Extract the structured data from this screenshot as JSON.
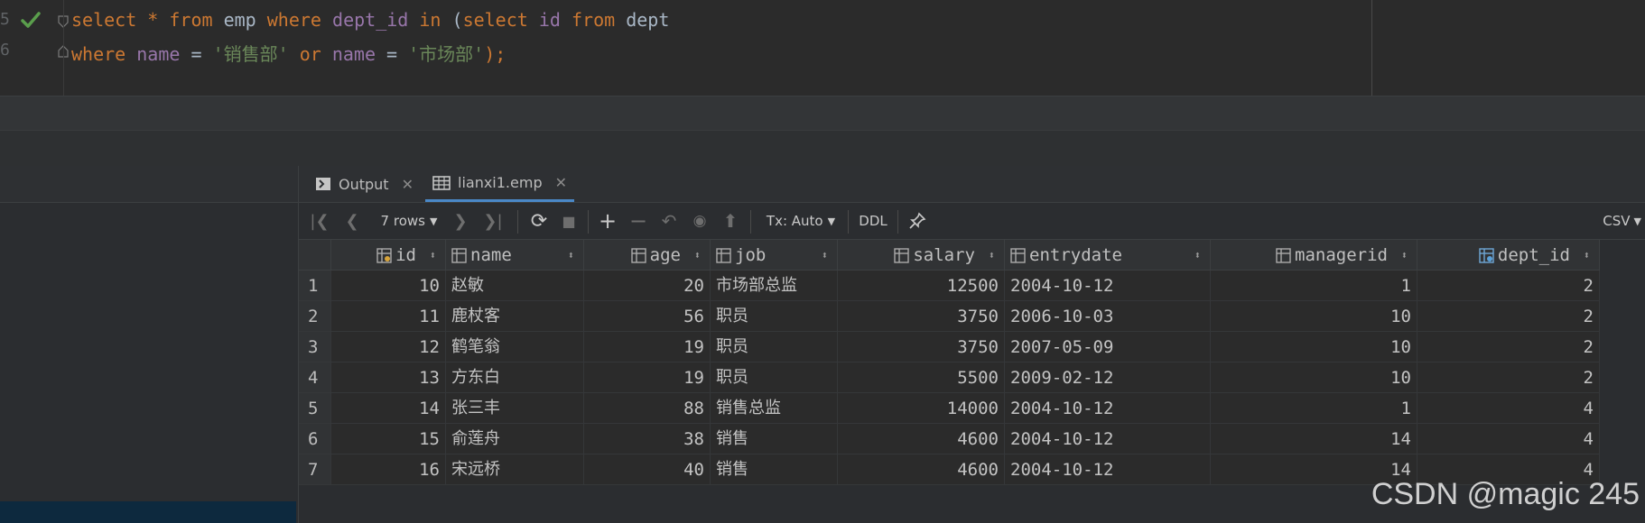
{
  "editor": {
    "line_numbers": [
      "5",
      "6"
    ],
    "line1": [
      "select",
      " * ",
      "from",
      " emp ",
      "where",
      " ",
      "dept_id",
      " ",
      "in",
      " (",
      "select",
      " ",
      "id",
      " ",
      "from",
      " dept"
    ],
    "line2": [
      "where",
      " ",
      "name",
      " = ",
      "'销售部'",
      " ",
      "or",
      " ",
      "name",
      " = ",
      "'市场部'",
      ");"
    ]
  },
  "results": {
    "tabs": [
      {
        "label": "Output",
        "icon": "console-icon"
      },
      {
        "label": "lianxi1.emp",
        "icon": "table-icon"
      }
    ],
    "toolbar": {
      "rows_label": "7 rows",
      "tx_label": "Tx: Auto",
      "ddl_label": "DDL",
      "csv_label": "CSV"
    },
    "columns": [
      "id",
      "name",
      "age",
      "job",
      "salary",
      "entrydate",
      "managerid",
      "dept_id"
    ],
    "rows": [
      [
        "1",
        "10",
        "赵敏",
        "20",
        "市场部总监",
        "12500",
        "2004-10-12",
        "1",
        "2"
      ],
      [
        "2",
        "11",
        "鹿杖客",
        "56",
        "职员",
        "3750",
        "2006-10-03",
        "10",
        "2"
      ],
      [
        "3",
        "12",
        "鹤笔翁",
        "19",
        "职员",
        "3750",
        "2007-05-09",
        "10",
        "2"
      ],
      [
        "4",
        "13",
        "方东白",
        "19",
        "职员",
        "5500",
        "2009-02-12",
        "10",
        "2"
      ],
      [
        "5",
        "14",
        "张三丰",
        "88",
        "销售总监",
        "14000",
        "2004-10-12",
        "1",
        "4"
      ],
      [
        "6",
        "15",
        "俞莲舟",
        "38",
        "销售",
        "4600",
        "2004-10-12",
        "14",
        "4"
      ],
      [
        "7",
        "16",
        "宋远桥",
        "40",
        "销售",
        "4600",
        "2004-10-12",
        "14",
        "4"
      ]
    ]
  },
  "watermark": "CSDN @magic 245",
  "colors": {
    "keyword": "#cc7832",
    "identifier": "#9876aa",
    "string": "#6a8759",
    "accent": "#4a88c7"
  }
}
